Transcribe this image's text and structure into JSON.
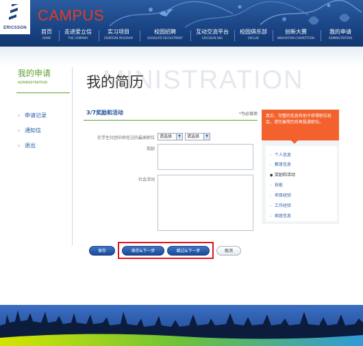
{
  "brand": {
    "logo_text": "ERICSSON",
    "campus": "CAMPUS"
  },
  "nav": [
    {
      "zh": "首页",
      "en": "HOME"
    },
    {
      "zh": "走进爱立信",
      "en": "THE COMPANY"
    },
    {
      "zh": "实习项目",
      "en": "ERINTERN PROGRAM"
    },
    {
      "zh": "校园招聘",
      "en": "GRADUATE RECRUITMENT"
    },
    {
      "zh": "互动交流平台",
      "en": "ERICSSON SNS"
    },
    {
      "zh": "校园俱乐部",
      "en": "ERCLUB"
    },
    {
      "zh": "创新大赛",
      "en": "INNOVATION COMPETITION"
    },
    {
      "zh": "我的申请",
      "en": "ADMINISTRATION"
    }
  ],
  "sidebar": {
    "title": "我的申请",
    "subtitle": "ADMINISTRATION",
    "items": [
      {
        "label": "申请记录"
      },
      {
        "label": "通知信"
      },
      {
        "label": "退出"
      }
    ]
  },
  "page": {
    "title": "我的简历",
    "watermark": "MINISTRATION"
  },
  "form": {
    "step_title": "3/7奖励和活动",
    "required_note": "为必填项",
    "required_star": "*",
    "position_label": "在学生社团中担任过的最高职位",
    "select1": "请选择",
    "select2": "请选择",
    "awards_label": "奖励",
    "activities_label": "社会活动"
  },
  "buttons": {
    "save": "保存",
    "save_next": "保存&下一步",
    "skip_next": "跳过&下一步",
    "cancel": "取消"
  },
  "tip": {
    "text": "真实、完整的信息有助于获得职位机会，请完善简历后再投递职位。"
  },
  "steps": [
    {
      "label": "个人信息",
      "active": false
    },
    {
      "label": "教育信息",
      "active": false
    },
    {
      "label": "奖励和活动",
      "active": true
    },
    {
      "label": "技能",
      "active": false
    },
    {
      "label": "项目经验",
      "active": false
    },
    {
      "label": "工作经验",
      "active": false
    },
    {
      "label": "家庭信息",
      "active": false
    }
  ],
  "colors": {
    "header_blue": "#17407f",
    "accent_green": "#5aa02c",
    "campus_red": "#e63b1f",
    "tip_orange": "#f3622d",
    "highlight_red": "#e3131b",
    "link_blue": "#2a5ea8"
  }
}
